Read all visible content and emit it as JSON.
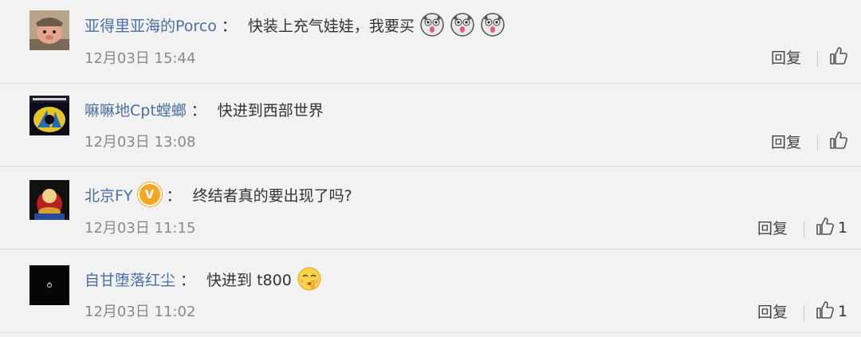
{
  "comments": [
    {
      "username": "亚得里亚海的Porco",
      "colon": "：",
      "text": "快装上充气娃娃，我要买",
      "emojis": [
        "dog-face-emoji",
        "dog-face-emoji",
        "dog-face-emoji"
      ],
      "time": "12月03日 15:44",
      "reply_label": "回复",
      "likes": ""
    },
    {
      "username": "嘛嘛地Cpt螳螂",
      "colon": "：",
      "text": "快进到西部世界",
      "time": "12月03日 13:08",
      "reply_label": "回复",
      "likes": ""
    },
    {
      "username": "北京FY",
      "verified_mark": "V",
      "colon": "：",
      "text": "终结者真的要出现了吗?",
      "time": "12月03日 11:15",
      "reply_label": "回复",
      "likes": "1"
    },
    {
      "username": "自甘堕落红尘",
      "colon": "：",
      "text": "快进到 t800",
      "emojis": [
        "shush-face-emoji"
      ],
      "time": "12月03日 11:02",
      "reply_label": "回复",
      "likes": "1"
    }
  ],
  "colors": {
    "background": "#f2f2f2",
    "username": "#4a6fa5",
    "timestamp": "#8a8a8a",
    "verified": "#f5a623"
  }
}
